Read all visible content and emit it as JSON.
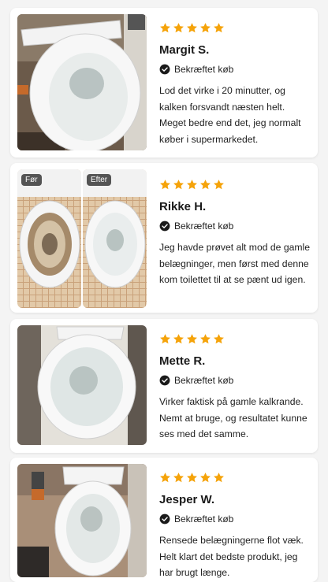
{
  "colors": {
    "star": "#f5a30a",
    "background": "#f4f4f4",
    "card": "#ffffff"
  },
  "reviews": [
    {
      "rating": 5,
      "name": "Margit S.",
      "verified": "Bekræftet køb",
      "text": "Lod det virke i 20 minutter, og kalken forsvandt næsten helt. Meget bedre end det, jeg normalt køber i supermarkedet."
    },
    {
      "rating": 5,
      "name": "Rikke H.",
      "verified": "Bekræftet køb",
      "text": "Jeg havde prøvet alt mod de gamle belægninger, men først med denne kom toilettet til at se pænt ud igen.",
      "before_label": "Før",
      "after_label": "Efter"
    },
    {
      "rating": 5,
      "name": "Mette R.",
      "verified": "Bekræftet køb",
      "text": "Virker faktisk på gamle kalkrande. Nemt at bruge, og resultatet kunne ses med det samme."
    },
    {
      "rating": 5,
      "name": "Jesper W.",
      "verified": "Bekræftet køb",
      "text": "Rensede belægningerne flot væk. Helt klart det bedste produkt, jeg har brugt længe."
    }
  ]
}
